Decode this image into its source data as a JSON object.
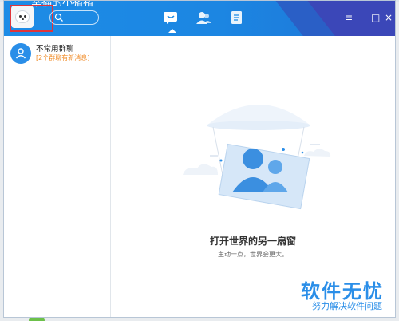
{
  "window": {
    "title_clipped": "幸福的小猪猪"
  },
  "toolbar": {
    "tabs": [
      {
        "name": "messages",
        "icon": "chat-bubble-icon",
        "active": true
      },
      {
        "name": "contacts",
        "icon": "contacts-icon",
        "active": false
      },
      {
        "name": "files",
        "icon": "document-icon",
        "active": false
      }
    ],
    "window_controls": {
      "menu": "≡",
      "minimize": "–",
      "maximize": "□",
      "close": "×"
    }
  },
  "search": {
    "icon": "search-icon"
  },
  "sidebar": {
    "items": [
      {
        "title": "不常用群聊",
        "subtitle": "[2个群聊有新消息]",
        "icon": "group-icon"
      }
    ]
  },
  "main": {
    "empty_title": "打开世界的另一扇窗",
    "empty_subtitle": "主动一点，世界会更大。"
  },
  "watermark": {
    "title": "软件无忧",
    "subtitle": "努力解决软件问题"
  },
  "colors": {
    "accent": "#1d8ce6",
    "highlight_box": "#e0353b",
    "subtitle_orange": "#f08a24"
  }
}
